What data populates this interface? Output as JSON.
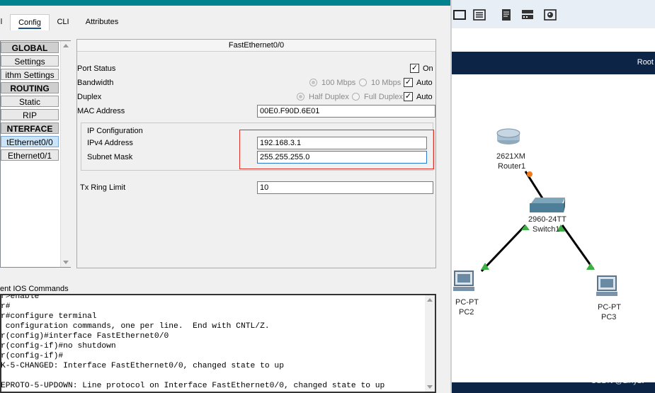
{
  "tabs": {
    "first": "l",
    "config": "Config",
    "cli": "CLI",
    "attributes": "Attributes"
  },
  "sidebar": {
    "items": [
      {
        "label": "GLOBAL",
        "type": "header"
      },
      {
        "label": "Settings",
        "type": "item"
      },
      {
        "label": "ithm Settings",
        "type": "item"
      },
      {
        "label": "ROUTING",
        "type": "header"
      },
      {
        "label": "Static",
        "type": "item"
      },
      {
        "label": "RIP",
        "type": "item"
      },
      {
        "label": "NTERFACE",
        "type": "header"
      },
      {
        "label": "tEthernet0/0",
        "type": "selected"
      },
      {
        "label": "Ethernet0/1",
        "type": "item"
      }
    ]
  },
  "panel": {
    "title": "FastEthernet0/0",
    "port_status_label": "Port Status",
    "port_status_on": "On",
    "port_status_checked": true,
    "bandwidth_label": "Bandwidth",
    "bw_100": "100 Mbps",
    "bw_10": "10 Mbps",
    "bw_auto": "Auto",
    "duplex_label": "Duplex",
    "half_duplex": "Half Duplex",
    "full_duplex": "Full Duplex",
    "duplex_auto": "Auto",
    "mac_label": "MAC Address",
    "mac_value": "00E0.F90D.6E01",
    "ip_config_label": "IP Configuration",
    "ipv4_label": "IPv4 Address",
    "ipv4_value": "192.168.3.1",
    "subnet_label": "Subnet Mask",
    "subnet_value": "255.255.255.0",
    "tx_ring_label": "Tx Ring Limit",
    "tx_ring_value": "10"
  },
  "console": {
    "label": "ent IOS Commands",
    "lines": [
      "r>enable",
      "r#",
      "r#configure terminal",
      " configuration commands, one per line.  End with CNTL/Z.",
      "r(config)#interface FastEthernet0/0",
      "r(config-if)#no shutdown",
      "r(config-if)#",
      "K-5-CHANGED: Interface FastEthernet0/0, changed state to up",
      "",
      "EPROTO-5-UPDOWN: Line protocol on Interface FastEthernet0/0, changed state to up"
    ]
  },
  "workspace": {
    "band_label": "Root",
    "watermark": "CSDN @Liny1t",
    "toolbar_icons": [
      "frame-icon",
      "list-icon",
      "notes-icon",
      "device-icon",
      "palette-icon"
    ],
    "devices": {
      "router_model": "2621XM",
      "router_name": "Router1",
      "switch_model": "2960-24TT",
      "switch_name": "Switch1",
      "pc2_model": "PC-PT",
      "pc2_name": "PC2",
      "pc3_model": "PC-PT",
      "pc3_name": "PC3"
    },
    "link_status_colors": {
      "up": "#3cb043",
      "amber": "#f07c1e"
    }
  },
  "colors": {
    "titlebar": "#00838f",
    "band": "#0c2546",
    "highlight_box": "#e0302a"
  }
}
